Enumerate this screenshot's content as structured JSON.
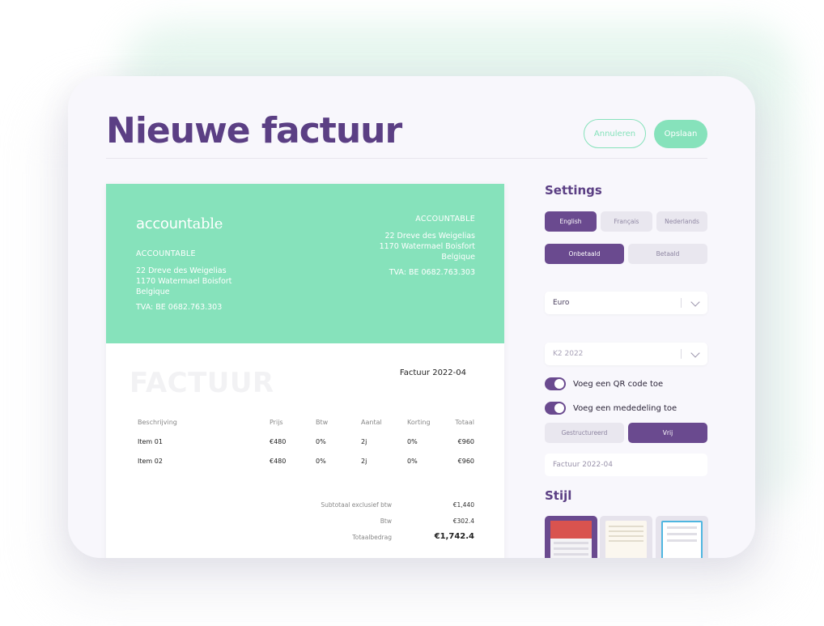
{
  "header": {
    "title": "Nieuwe factuur",
    "cancel_label": "Annuleren",
    "save_label": "Opslaan"
  },
  "invoice": {
    "logo": {
      "bold": "account",
      "light": "able"
    },
    "sender": {
      "name": "ACCOUNTABLE",
      "address": [
        "22 Dreve des Weigelias",
        "1170 Watermael Boisfort",
        "Belgique"
      ],
      "vat": "TVA: BE 0682.763.303"
    },
    "recipient": {
      "name": "ACCOUNTABLE",
      "address": [
        "22 Dreve des Weigelias",
        "1170 Watermael Boisfort",
        "Belgique"
      ],
      "vat": "TVA: BE 0682.763.303"
    },
    "doc_word": "FACTUUR",
    "number": "Factuur 2022-04",
    "columns": [
      "Beschrijving",
      "Prijs",
      "Btw",
      "Aantal",
      "Korting",
      "Totaal"
    ],
    "rows": [
      [
        "Item 01",
        "€480",
        "0%",
        "2j",
        "0%",
        "€960"
      ],
      [
        "Item 02",
        "€480",
        "0%",
        "2j",
        "0%",
        "€960"
      ]
    ],
    "totals": {
      "subtotal_label": "Subtotaal exclusief btw",
      "subtotal_value": "€1,440",
      "vat_label": "Btw",
      "vat_value": "€302.4",
      "total_label": "Totaalbedrag",
      "total_value": "€1,742.4"
    }
  },
  "settings": {
    "title": "Settings",
    "languages": [
      "English",
      "Français",
      "Nederlands"
    ],
    "language_selected": "English",
    "status_options": [
      "Onbetaald",
      "Betaald"
    ],
    "status_selected": "Onbetaald",
    "currency": "Euro",
    "period_placeholder": "K2 2022",
    "qr_toggle_label": "Voeg een QR code toe",
    "qr_toggle_on": true,
    "message_toggle_label": "Voeg een mededeling toe",
    "message_toggle_on": true,
    "message_types": [
      "Gestructureerd",
      "Vrij"
    ],
    "message_type_selected": "Vrij",
    "message_placeholder": "Factuur 2022-04",
    "style_title": "Stijl"
  },
  "colors": {
    "brand_purple": "#5b3f84",
    "accent_green": "#86e2bb",
    "active_segment": "#6a4a8f"
  }
}
